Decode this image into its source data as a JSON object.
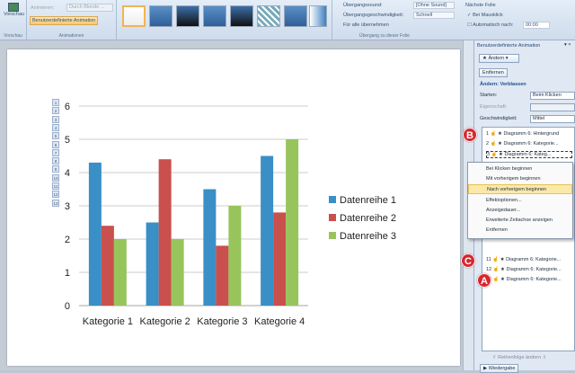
{
  "ribbon": {
    "preview": "Vorschau",
    "preview_group": "Vorschau",
    "animate_label": "Animieren:",
    "animate_value": "Durch Blende ...",
    "custom_anim": "Benutzerdefinierte Animation",
    "anim_group": "Animationen",
    "transition_sound_label": "Übergangssound:",
    "transition_sound_value": "[Ohne Sound]",
    "transition_speed_label": "Übergangsgeschwindigkeit:",
    "transition_speed_value": "Schnell",
    "apply_all": "Für alle übernehmen",
    "transition_group": "Übergang zu dieser Folie",
    "next_slide": "Nächste Folie",
    "on_click": "Bei Mausklick",
    "auto_after": "Automatisch nach:",
    "auto_time": "00:00"
  },
  "pane": {
    "title": "Benutzerdefinierte Animation",
    "change_btn": "Ändern",
    "remove_btn": "Entfernen",
    "heading": "Ändern: Verblassen",
    "start_label": "Starten:",
    "start_value": "Beim Klicken",
    "property_label": "Eigenschaft:",
    "speed_label": "Geschwindigkeit:",
    "speed_value": "Mittel",
    "items": [
      {
        "n": "1",
        "text": "Diagramm 6: Hintergrund"
      },
      {
        "n": "2",
        "text": "Diagramm 6: Kategorie..."
      },
      {
        "n": "3",
        "text": "Diagramm 6: Kateg..."
      },
      {
        "n": "11",
        "text": "Diagramm 6: Kategorie..."
      },
      {
        "n": "12",
        "text": "Diagramm 6: Kategorie..."
      },
      {
        "n": "13",
        "text": "Diagramm 6: Kategorie..."
      }
    ],
    "order_label": "Reihenfolge ändern",
    "play_btn": "Wiedergabe"
  },
  "context_menu": [
    "Bei Klicken beginnen",
    "Mit vorherigem beginnen",
    "Nach vorherigem beginnen",
    "Effektoptionen...",
    "Anzeigedauer...",
    "Erweiterte Zeitachse anzeigen",
    "Entfernen"
  ],
  "markers": {
    "a": "A",
    "b": "B",
    "c": "C"
  },
  "tags": [
    "1",
    "2",
    "3",
    "4",
    "5",
    "6",
    "7",
    "8",
    "9",
    "10",
    "11",
    "12",
    "13"
  ],
  "chart_data": {
    "type": "bar",
    "categories": [
      "Kategorie 1",
      "Kategorie 2",
      "Kategorie 3",
      "Kategorie 4"
    ],
    "series": [
      {
        "name": "Datenreihe 1",
        "values": [
          4.3,
          2.5,
          3.5,
          4.5
        ],
        "color": "#3a8fc6"
      },
      {
        "name": "Datenreihe 2",
        "values": [
          2.4,
          4.4,
          1.8,
          2.8
        ],
        "color": "#c9504d"
      },
      {
        "name": "Datenreihe 3",
        "values": [
          2,
          2,
          3,
          5
        ],
        "color": "#98c45c"
      }
    ],
    "ylim": [
      0,
      6
    ],
    "yticks": [
      "0",
      "1",
      "2",
      "3",
      "4",
      "5",
      "6"
    ],
    "grid": true,
    "legend": "right"
  }
}
